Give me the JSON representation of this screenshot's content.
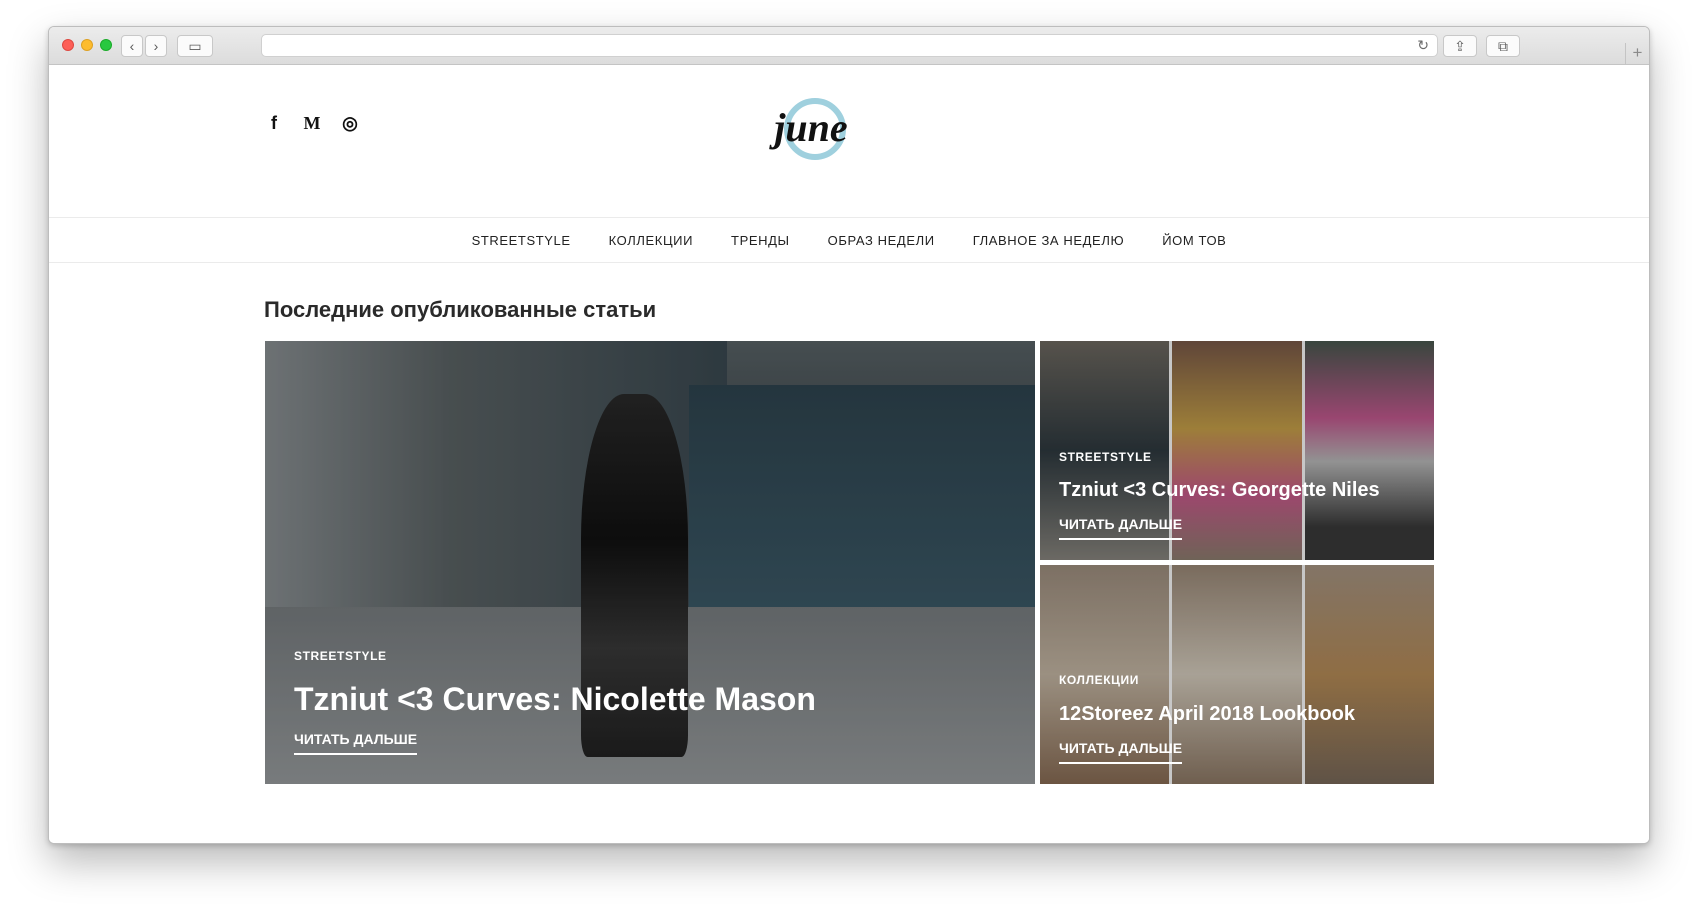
{
  "browser": {
    "back_glyph": "‹",
    "forward_glyph": "›",
    "sidebar_glyph": "▭",
    "reload_glyph": "↻",
    "share_glyph": "⇪",
    "tabs_glyph": "⧉",
    "newtab_glyph": "+",
    "url": ""
  },
  "header": {
    "social": [
      {
        "icon": "facebook-icon",
        "glyph": "f"
      },
      {
        "icon": "medium-icon",
        "glyph": "M"
      },
      {
        "icon": "instagram-icon",
        "glyph": "◎"
      }
    ],
    "logo_text": "june",
    "logo_ring_color": "#9fd0de"
  },
  "nav": {
    "items": [
      "STREETSTYLE",
      "КОЛЛЕКЦИИ",
      "ТРЕНДЫ",
      "ОБРАЗ НЕДЕЛИ",
      "ГЛАВНОЕ ЗА НЕДЕЛЮ",
      "ЙОМ ТОВ"
    ]
  },
  "section": {
    "title": "Последние опубликованные статьи"
  },
  "articles": [
    {
      "category": "STREETSTYLE",
      "title": "Tzniut <3 Curves: Nicolette Mason",
      "read_more": "ЧИТАТЬ ДАЛЬШЕ"
    },
    {
      "category": "STREETSTYLE",
      "title": "Tzniut <3 Curves: Georgette Niles",
      "read_more": "ЧИТАТЬ ДАЛЬШЕ"
    },
    {
      "category": "КОЛЛЕКЦИИ",
      "title": "12Storeez April 2018 Lookbook",
      "read_more": "ЧИТАТЬ ДАЛЬШЕ"
    }
  ]
}
